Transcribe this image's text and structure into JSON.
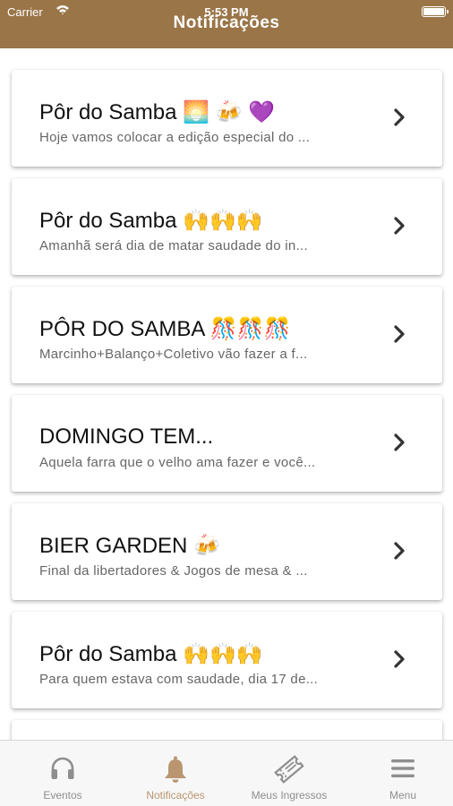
{
  "status_bar": {
    "carrier": "Carrier",
    "time": "5:53 PM"
  },
  "header": {
    "title": "Notificações"
  },
  "notifications": [
    {
      "title": "Pôr do Samba 🌅 🍻 💜",
      "preview": "Hoje vamos colocar a edição especial do ..."
    },
    {
      "title": "Pôr do Samba 🙌🙌🙌",
      "preview": "Amanhã será dia de matar saudade do in..."
    },
    {
      "title": "PÔR DO SAMBA 🎊🎊🎊",
      "preview": "Marcinho+Balanço+Coletivo vão fazer a f..."
    },
    {
      "title": "DOMINGO TEM...",
      "preview": "Aquela farra que o velho ama fazer e você..."
    },
    {
      "title": "BIER GARDEN 🍻",
      "preview": "Final da libertadores & Jogos de mesa & ..."
    },
    {
      "title": "Pôr do Samba 🙌🙌🙌",
      "preview": "Para quem estava com saudade, dia 17 de..."
    }
  ],
  "tabbar": {
    "active_color": "#b99670",
    "inactive_color": "#8e8e8e",
    "items": [
      {
        "label": "Eventos",
        "icon": "headphones-icon"
      },
      {
        "label": "Notificações",
        "icon": "bell-icon"
      },
      {
        "label": "Meus Ingressos",
        "icon": "ticket-icon"
      },
      {
        "label": "Menu",
        "icon": "menu-icon"
      }
    ]
  },
  "colors": {
    "header": "#9a7548"
  }
}
